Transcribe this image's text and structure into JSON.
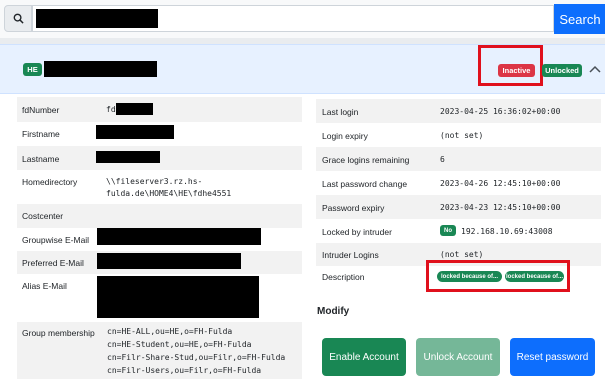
{
  "search": {
    "button_label": "Search"
  },
  "header": {
    "org_badge": "HE",
    "status_inactive": "Inactive",
    "status_unlocked": "Unlocked"
  },
  "left_fields": [
    {
      "label": "fdNumber",
      "value": "fd"
    },
    {
      "label": "Firstname",
      "value": ""
    },
    {
      "label": "Lastname",
      "value": ""
    },
    {
      "label": "Homedirectory",
      "value_lines": [
        "\\\\fileserver3.rz.hs-",
        "fulda.de\\HOME4\\HE\\fdhe4551"
      ]
    },
    {
      "label": "Costcenter",
      "value": ""
    },
    {
      "label": "Groupwise E-Mail",
      "value": ""
    },
    {
      "label": "Preferred E-Mail",
      "value": ""
    },
    {
      "label": "Alias E-Mail",
      "value": ""
    },
    {
      "label": "Group membership",
      "value_lines": [
        "cn=HE-ALL,ou=HE,o=FH-Fulda",
        "cn=HE-Student,ou=HE,o=FH-Fulda",
        "cn=Filr-Share-Stud,ou=Filr,o=FH-Fulda",
        "cn=Filr-Users,ou=Filr,o=FH-Fulda"
      ]
    }
  ],
  "right_fields": [
    {
      "label": "Last login",
      "value": "2023-04-25 16:36:02+00:00"
    },
    {
      "label": "Login expiry",
      "value": "(not set)"
    },
    {
      "label": "Grace logins remaining",
      "value": "6"
    },
    {
      "label": "Last password change",
      "value": "2023-04-26 12:45:10+00:00"
    },
    {
      "label": "Password expiry",
      "value": "2023-04-23 12:45:10+00:00"
    },
    {
      "label": "Locked by intruder",
      "badge": "No",
      "value": "192.168.10.69:43008"
    },
    {
      "label": "Intruder Logins",
      "value": "(not set)"
    },
    {
      "label": "Description",
      "badges": [
        "locked because of...",
        "locked because of..."
      ]
    }
  ],
  "modify": {
    "title": "Modify",
    "buttons": {
      "enable": "Enable Account",
      "unlock": "Unlock Account",
      "reset": "Reset password"
    }
  },
  "colors": {
    "primary": "#0d6efd",
    "success": "#198754",
    "danger": "#dc3545",
    "highlight": "#e0101c"
  }
}
